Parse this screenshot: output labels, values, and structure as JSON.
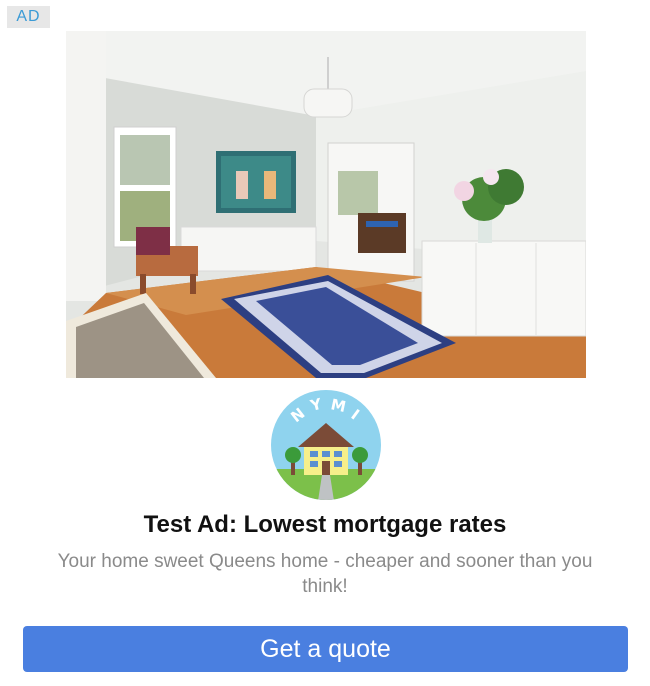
{
  "ad": {
    "badge": "AD",
    "logo_text": "NYMI",
    "headline": "Test Ad: Lowest mortgage rates",
    "body": "Your home sweet Queens home - cheaper and sooner than you think!",
    "cta_label": "Get a quote",
    "hero_image": "living-room-photo",
    "colors": {
      "badge_text": "#3b9bd6",
      "badge_bg": "#e7e7e7",
      "cta_bg": "#4a7fe0",
      "cta_text": "#ffffff",
      "headline": "#111111",
      "body": "#8a8a8a",
      "logo_circle": "#8fd3ee"
    }
  }
}
